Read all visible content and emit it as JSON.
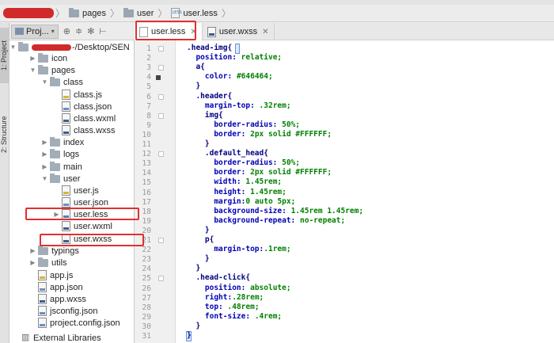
{
  "breadcrumb": {
    "items": [
      "pages",
      "user",
      "user.less"
    ]
  },
  "side_tabs": {
    "project": "1: Project",
    "structure": "2: Structure"
  },
  "project_panel": {
    "dropdown_label": "Proj...",
    "root_path": "-/Desktop/SEN"
  },
  "tree": [
    {
      "label": "icon",
      "type": "folder",
      "depth": 1,
      "expanded": false
    },
    {
      "label": "pages",
      "type": "folder",
      "depth": 1,
      "expanded": true
    },
    {
      "label": "class",
      "type": "folder",
      "depth": 2,
      "expanded": true
    },
    {
      "label": "class.js",
      "type": "js",
      "depth": 3
    },
    {
      "label": "class.json",
      "type": "json",
      "depth": 3
    },
    {
      "label": "class.wxml",
      "type": "wxml",
      "depth": 3
    },
    {
      "label": "class.wxss",
      "type": "wxml",
      "depth": 3
    },
    {
      "label": "index",
      "type": "folder",
      "depth": 2,
      "expanded": false
    },
    {
      "label": "logs",
      "type": "folder",
      "depth": 2,
      "expanded": false
    },
    {
      "label": "main",
      "type": "folder",
      "depth": 2,
      "expanded": false
    },
    {
      "label": "user",
      "type": "folder",
      "depth": 2,
      "expanded": true
    },
    {
      "label": "user.js",
      "type": "js",
      "depth": 3
    },
    {
      "label": "user.json",
      "type": "json",
      "depth": 3
    },
    {
      "label": "user.less",
      "type": "less",
      "depth": 3,
      "arrow": true
    },
    {
      "label": "user.wxml",
      "type": "wxml",
      "depth": 3
    },
    {
      "label": "user.wxss",
      "type": "wxml",
      "depth": 3
    },
    {
      "label": "typings",
      "type": "folder",
      "depth": 1,
      "expanded": false
    },
    {
      "label": "utils",
      "type": "folder",
      "depth": 1,
      "expanded": false
    },
    {
      "label": "app.js",
      "type": "js",
      "depth": 1
    },
    {
      "label": "app.json",
      "type": "json",
      "depth": 1
    },
    {
      "label": "app.wxss",
      "type": "wxml",
      "depth": 1
    },
    {
      "label": "jsconfig.json",
      "type": "json",
      "depth": 1
    },
    {
      "label": "project.config.json",
      "type": "json",
      "depth": 1
    },
    {
      "label": "External Libraries",
      "type": "lib",
      "depth": 0
    }
  ],
  "editor_tabs": [
    {
      "label": "user.less",
      "active": true
    },
    {
      "label": "user.wxss",
      "active": false
    }
  ],
  "code_lines": [
    ".head-img{",
    "  position: relative;",
    "  a{",
    "    color: #646464;",
    "  }",
    "  .header{",
    "    margin-top: .32rem;",
    "    img{",
    "      border-radius: 50%;",
    "      border: 2px solid #FFFFFF;",
    "    }",
    "    .default_head{",
    "      border-radius: 50%;",
    "      border: 2px solid #FFFFFF;",
    "      width: 1.45rem;",
    "      height: 1.45rem;",
    "      margin:0 auto 5px;",
    "      background-size: 1.45rem 1.45rem;",
    "      background-repeat: no-repeat;",
    "    }",
    "    p{",
    "      margin-top:.1rem;",
    "    }",
    "  }",
    "  .head-click{",
    "    position: absolute;",
    "    right:.28rem;",
    "    top: .48rem;",
    "    font-size: .4rem;",
    "  }",
    "}"
  ],
  "colors": {
    "highlight_red": "#e03030",
    "selector": "#000080",
    "value": "#008000"
  }
}
